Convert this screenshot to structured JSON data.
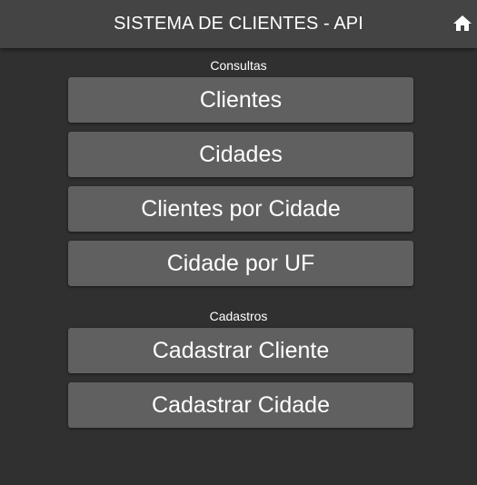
{
  "header": {
    "title": "SISTEMA DE CLIENTES - API",
    "home_icon": "home-icon"
  },
  "consultas": {
    "heading": "Consultas",
    "buttons": [
      {
        "label": "Clientes"
      },
      {
        "label": "Cidades"
      },
      {
        "label": "Clientes por Cidade"
      },
      {
        "label": "Cidade por UF"
      }
    ]
  },
  "cadastros": {
    "heading": "Cadastros",
    "buttons": [
      {
        "label": "Cadastrar Cliente"
      },
      {
        "label": "Cadastrar Cidade"
      }
    ]
  },
  "colors": {
    "background": "#303030",
    "header": "#444444",
    "button": "#606060",
    "text": "#ffffff"
  }
}
